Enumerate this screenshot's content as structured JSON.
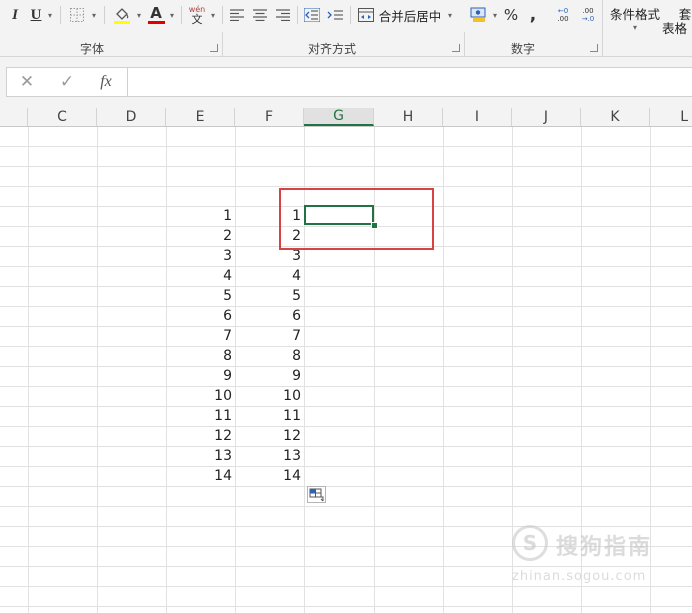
{
  "ribbon": {
    "italic_label": "I",
    "underline_label": "U",
    "phonetic_top": "wén",
    "phonetic_bottom": "文",
    "font_color_letter": "A",
    "merge_center_label": "合并后居中",
    "percent_label": "%",
    "comma_label": ",",
    "inc_decimal_top": "←0",
    "inc_decimal_bottom": ".00",
    "dec_decimal_top": ".00",
    "dec_decimal_bottom": "→.0",
    "conditional_format_label": "条件格式",
    "table_style_label_top": "套",
    "table_style_label_bottom": "表格",
    "groups": {
      "font": "字体",
      "alignment": "对齐方式",
      "number": "数字"
    },
    "colors": {
      "highlight": "#ffff00",
      "font_color": "#e00000"
    }
  },
  "formula_bar": {
    "cancel_icon": "✕",
    "enter_icon": "✓",
    "fx_label": "fx",
    "content": ""
  },
  "columns": [
    "C",
    "D",
    "E",
    "F",
    "G",
    "H",
    "I",
    "J",
    "K",
    "L"
  ],
  "selected_column": "G",
  "column_e_values": [
    "1",
    "2",
    "3",
    "4",
    "5",
    "6",
    "7",
    "8",
    "9",
    "10",
    "11",
    "12",
    "13",
    "14"
  ],
  "column_f_values": [
    "1",
    "2",
    "3",
    "4",
    "5",
    "6",
    "7",
    "8",
    "9",
    "10",
    "11",
    "12",
    "13",
    "14"
  ],
  "watermark": {
    "logo_char": "S",
    "text": "搜狗指南",
    "url": "zhinan.sogou.com"
  },
  "accent_colors": {
    "excel_green": "#217346",
    "annotation_red": "#d9433f"
  }
}
